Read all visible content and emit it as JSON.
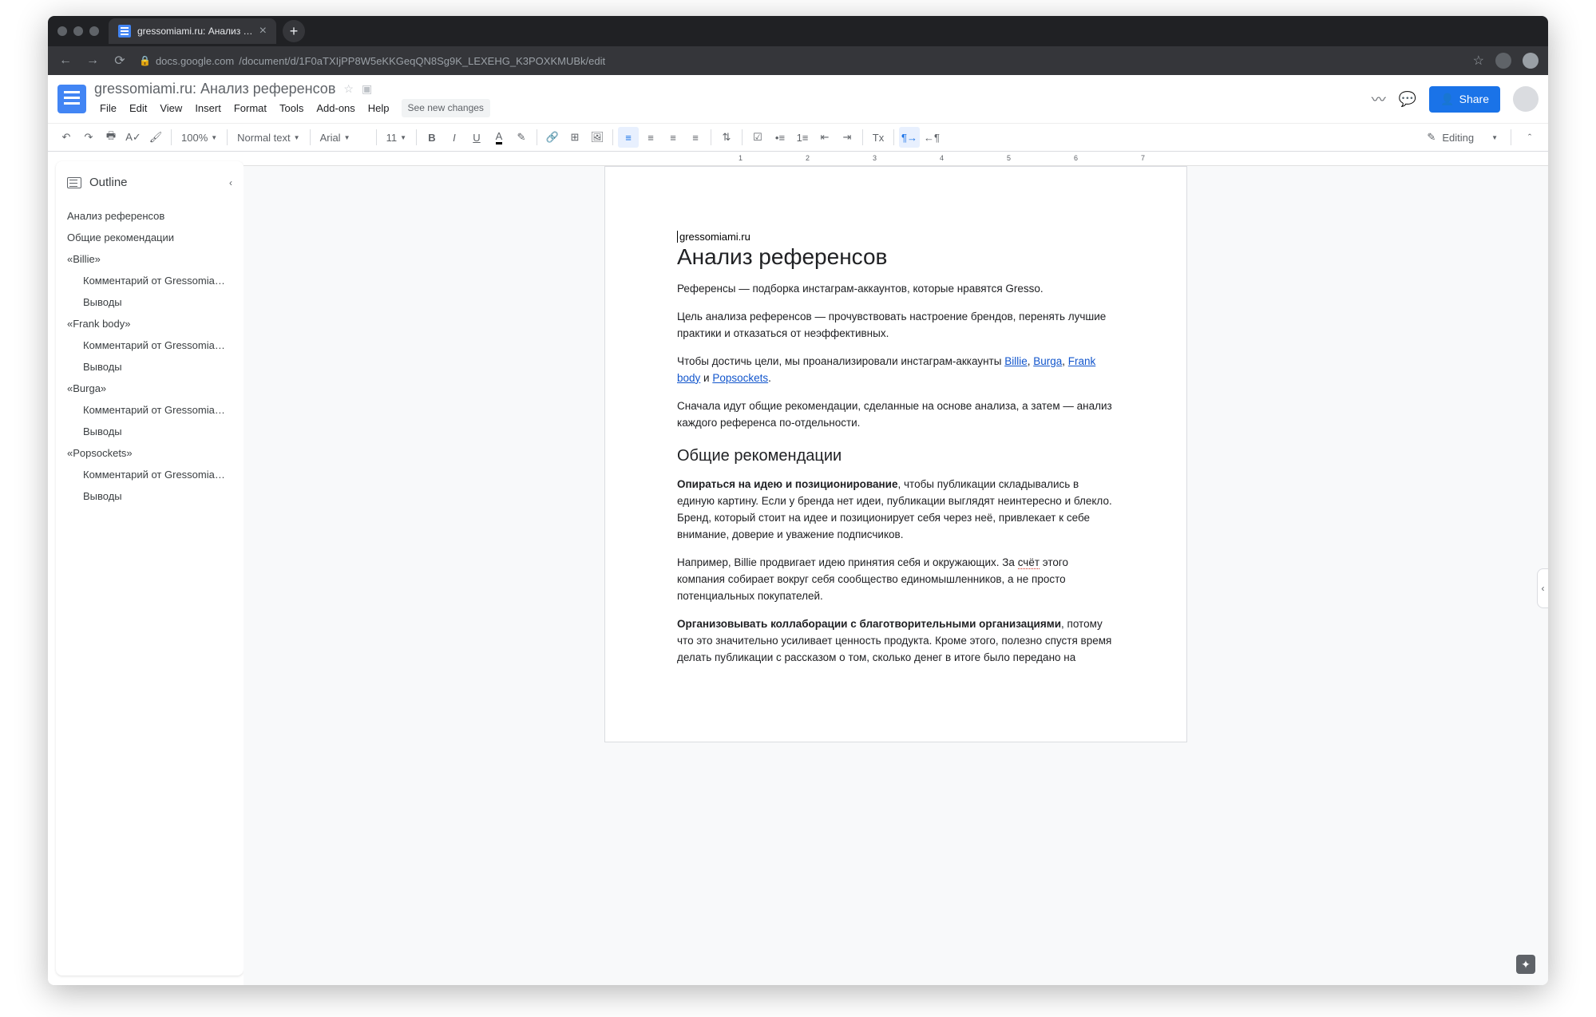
{
  "browser": {
    "tab_title": "gressomiami.ru: Анализ рефер",
    "url_host": "docs.google.com",
    "url_path": "/document/d/1F0aTXIjPP8W5eKKGeqQN8Sg9K_LEXEHG_K3POXKMUBk/edit"
  },
  "header": {
    "doc_title": "gressomiami.ru: Анализ референсов",
    "menus": [
      "File",
      "Edit",
      "View",
      "Insert",
      "Format",
      "Tools",
      "Add-ons",
      "Help"
    ],
    "see_changes": "See new changes",
    "share_label": "Share"
  },
  "toolbar": {
    "zoom": "100%",
    "style": "Normal text",
    "font": "Arial",
    "size": "11",
    "editing": "Editing"
  },
  "outline": {
    "title": "Outline",
    "items": [
      {
        "l": 0,
        "t": "Анализ референсов"
      },
      {
        "l": 0,
        "t": "Общие рекомендации"
      },
      {
        "l": 0,
        "t": "«Billie»"
      },
      {
        "l": 1,
        "t": "Комментарий от Gressomiami..."
      },
      {
        "l": 1,
        "t": "Выводы"
      },
      {
        "l": 0,
        "t": "«Frank body»"
      },
      {
        "l": 1,
        "t": "Комментарий от Gressomiami..."
      },
      {
        "l": 1,
        "t": "Выводы"
      },
      {
        "l": 0,
        "t": "«Burga»"
      },
      {
        "l": 1,
        "t": "Комментарий от Gressomiami..."
      },
      {
        "l": 1,
        "t": "Выводы"
      },
      {
        "l": 0,
        "t": "«Popsockets»"
      },
      {
        "l": 1,
        "t": "Комментарий от Gressomiami..."
      },
      {
        "l": 1,
        "t": "Выводы"
      }
    ]
  },
  "document": {
    "kicker": "gressomiami.ru",
    "h1": "Анализ референсов",
    "p1": "Референсы — подборка инстаграм-аккаунтов, которые нравятся Gresso.",
    "p2": "Цель анализа референсов — прочувствовать настроение брендов, перенять лучшие практики и отказаться от неэффективных.",
    "p3_a": "Чтобы достичь цели, мы проанализировали инстаграм-аккаунты ",
    "link1": "Billie",
    "sep1": ", ",
    "link2": "Burga",
    "sep2": ", ",
    "link3": "Frank body",
    "p3_b": " и ",
    "link4": "Popsockets",
    "p3_c": ".",
    "p4": "Сначала идут общие рекомендации, сделанные на основе анализа, а затем — анализ каждого референса по-отдельности.",
    "h2": "Общие рекомендации",
    "p5_b": "Опираться на идею и позиционирование",
    "p5": ", чтобы публикации складывались в единую картину. Если у бренда нет идеи, публикации выглядят неинтересно и блекло. Бренд, который стоит на идее и позиционирует себя через неё, привлекает к себе внимание, доверие и уважение подписчиков.",
    "p6_a": "Например, Billie продвигает идею принятия себя и окружающих. За ",
    "p6_spell": "счёт",
    "p6_b": " этого компания собирает вокруг себя сообщество единомышленников, а не просто потенциальных покупателей.",
    "p7_b": "Организовывать коллаборации с благотворительными организациями",
    "p7": ", потому что это значительно усиливает ценность продукта. Кроме этого, полезно спустя время делать публикации с рассказом о том, сколько денег в итоге было передано на"
  }
}
